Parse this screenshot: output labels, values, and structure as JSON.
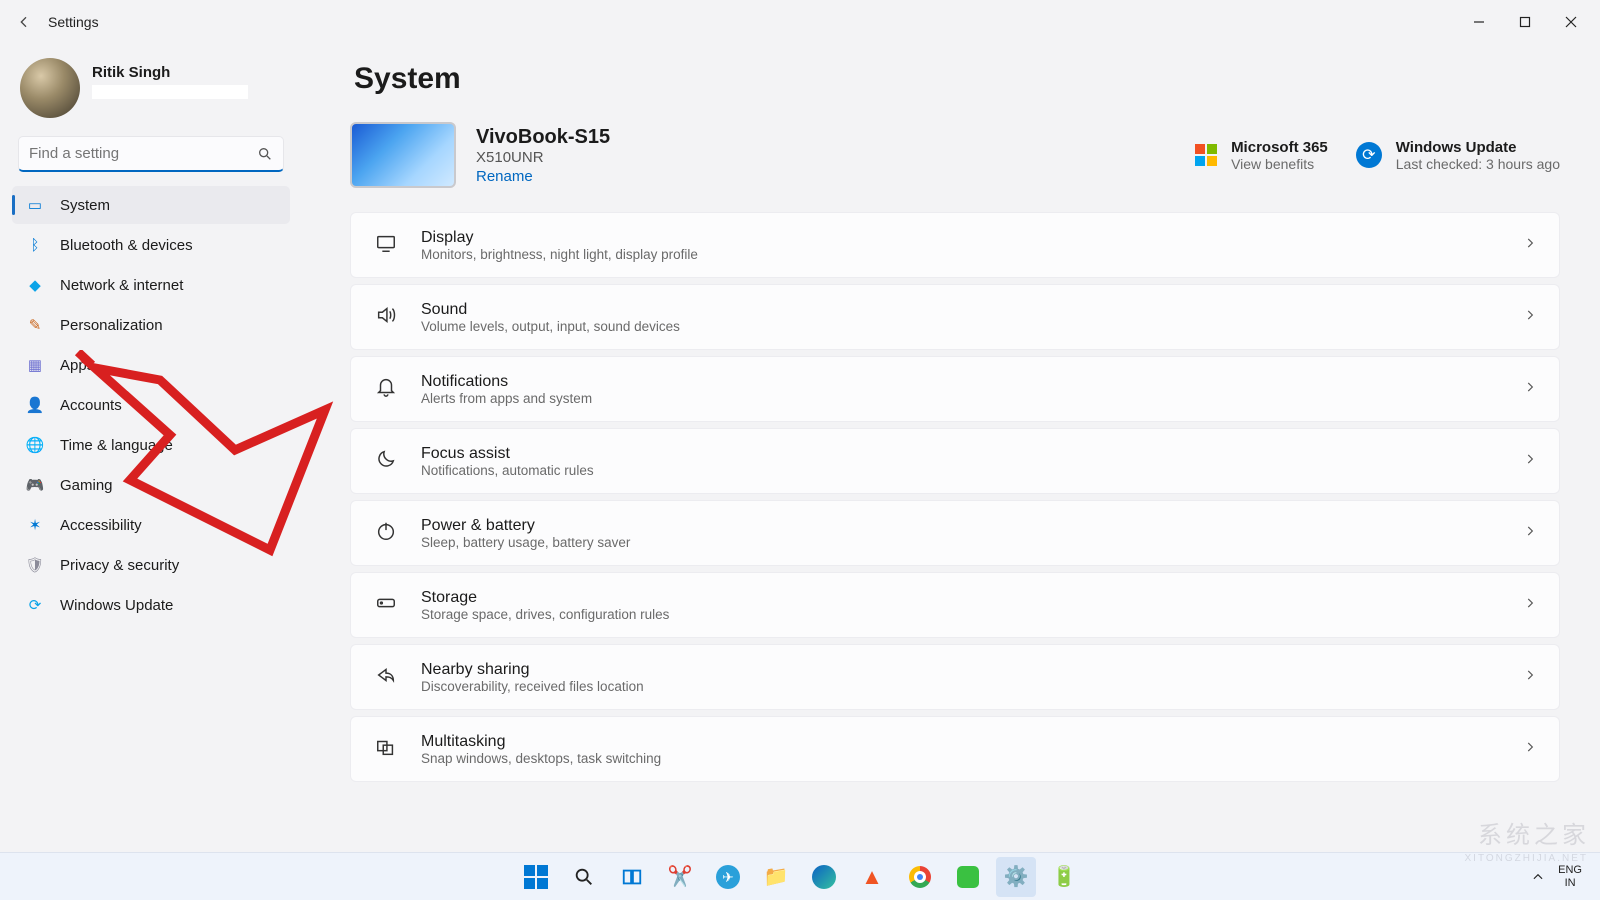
{
  "window": {
    "title": "Settings"
  },
  "user": {
    "name": "Ritik Singh"
  },
  "search": {
    "placeholder": "Find a setting"
  },
  "sidebar": {
    "items": [
      {
        "label": "System",
        "icon": "🖥️",
        "active": true
      },
      {
        "label": "Bluetooth & devices",
        "icon": "B"
      },
      {
        "label": "Network & internet",
        "icon": "📶"
      },
      {
        "label": "Personalization",
        "icon": "🖌️"
      },
      {
        "label": "Apps",
        "icon": "▦"
      },
      {
        "label": "Accounts",
        "icon": "👤"
      },
      {
        "label": "Time & language",
        "icon": "🌐"
      },
      {
        "label": "Gaming",
        "icon": "🎮"
      },
      {
        "label": "Accessibility",
        "icon": "♿"
      },
      {
        "label": "Privacy & security",
        "icon": "🛡️"
      },
      {
        "label": "Windows Update",
        "icon": "🔄"
      }
    ]
  },
  "page": {
    "title": "System",
    "device": {
      "name": "VivoBook-S15",
      "model": "X510UNR",
      "rename": "Rename"
    },
    "cards": {
      "ms365": {
        "title": "Microsoft 365",
        "sub": "View benefits"
      },
      "update": {
        "title": "Windows Update",
        "sub": "Last checked: 3 hours ago"
      }
    },
    "settings": [
      {
        "key": "display",
        "title": "Display",
        "sub": "Monitors, brightness, night light, display profile"
      },
      {
        "key": "sound",
        "title": "Sound",
        "sub": "Volume levels, output, input, sound devices"
      },
      {
        "key": "notifications",
        "title": "Notifications",
        "sub": "Alerts from apps and system"
      },
      {
        "key": "focus",
        "title": "Focus assist",
        "sub": "Notifications, automatic rules"
      },
      {
        "key": "power",
        "title": "Power & battery",
        "sub": "Sleep, battery usage, battery saver"
      },
      {
        "key": "storage",
        "title": "Storage",
        "sub": "Storage space, drives, configuration rules"
      },
      {
        "key": "nearby",
        "title": "Nearby sharing",
        "sub": "Discoverability, received files location"
      },
      {
        "key": "multitask",
        "title": "Multitasking",
        "sub": "Snap windows, desktops, task switching"
      }
    ]
  },
  "taskbar": {
    "lang1": "ENG",
    "lang2": "IN"
  },
  "watermark": {
    "text": "系统之家",
    "sub": "XITONGZHIJIA.NET"
  }
}
